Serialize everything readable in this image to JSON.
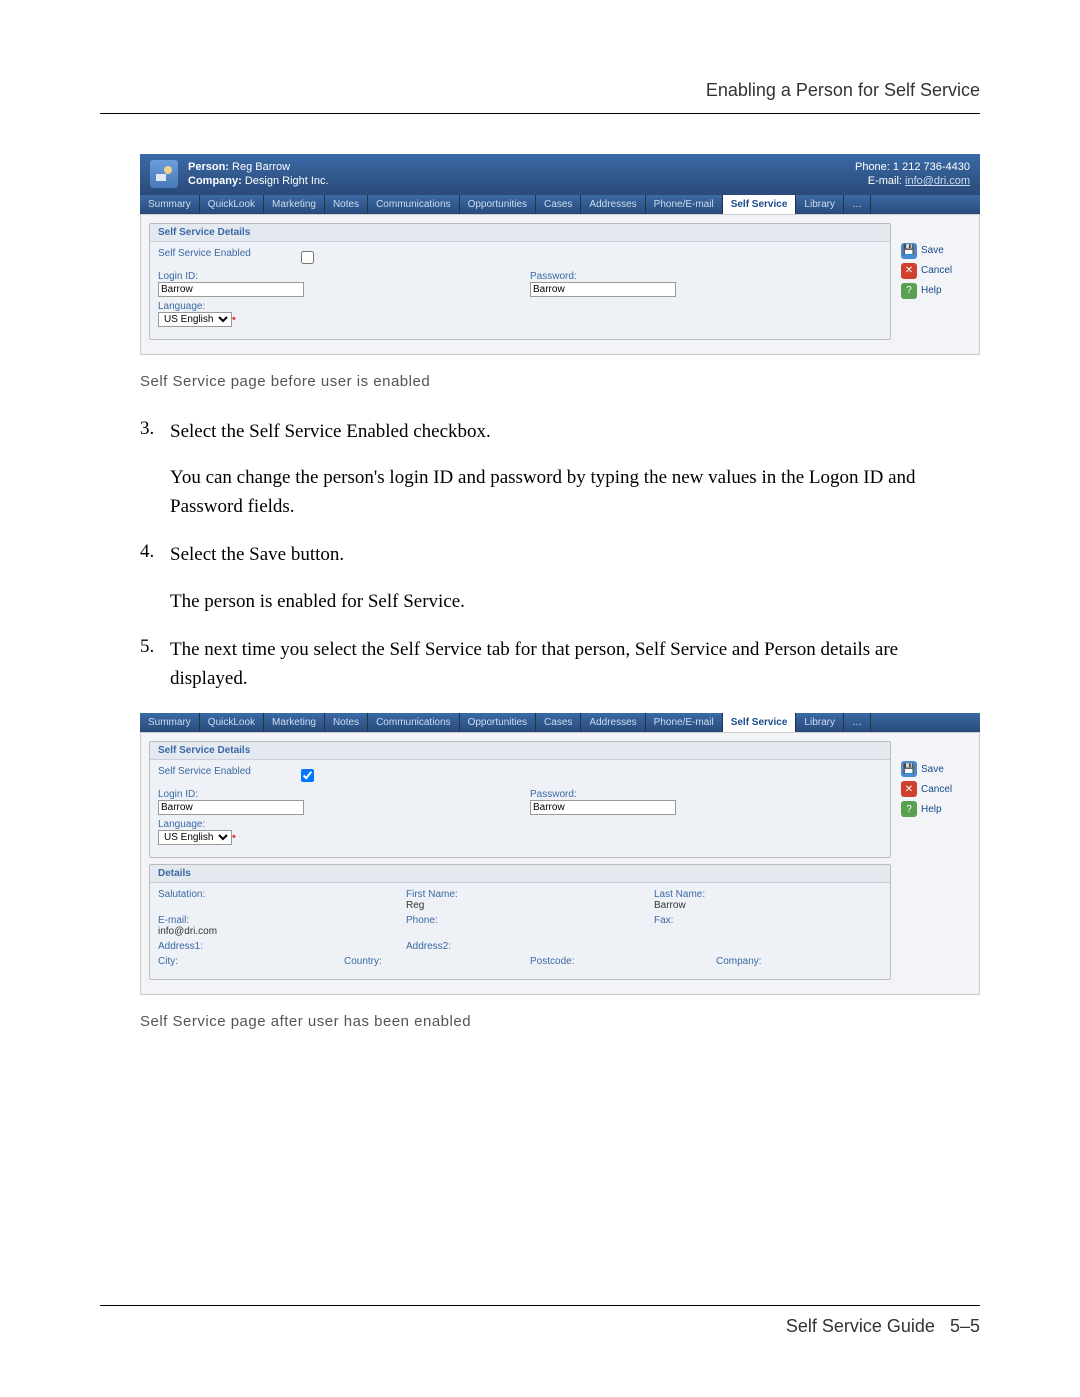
{
  "header": "Enabling a Person for Self Service",
  "shot1": {
    "person_label": "Person:",
    "person": "Reg Barrow",
    "company_label": "Company:",
    "company": "Design Right Inc.",
    "phone_label": "Phone:",
    "phone": "1 212 736-4430",
    "email_label": "E-mail:",
    "email": "info@dri.com",
    "tabs": [
      "Summary",
      "QuickLook",
      "Marketing",
      "Notes",
      "Communications",
      "Opportunities",
      "Cases",
      "Addresses",
      "Phone/E-mail",
      "Self Service",
      "Library",
      "…"
    ],
    "panel_title": "Self Service Details",
    "sse_label": "Self Service Enabled",
    "login_label": "Login ID:",
    "login_val": "Barrow",
    "password_label": "Password:",
    "password_val": "Barrow",
    "language_label": "Language:",
    "language_val": "US English",
    "save": "Save",
    "cancel": "Cancel",
    "help": "Help"
  },
  "caption1": "Self Service page before user is enabled",
  "steps": [
    {
      "n": "3.",
      "p": [
        "Select the Self Service Enabled checkbox.",
        "You can change the person's login ID and password by typing the new values in the Logon ID and Password fields."
      ]
    },
    {
      "n": "4.",
      "p": [
        "Select the Save button.",
        "The person is enabled for Self Service."
      ]
    },
    {
      "n": "5.",
      "p": [
        "The next time you select the Self Service tab for that person, Self Service and Person details are displayed."
      ]
    }
  ],
  "shot2": {
    "tabs": [
      "Summary",
      "QuickLook",
      "Marketing",
      "Notes",
      "Communications",
      "Opportunities",
      "Cases",
      "Addresses",
      "Phone/E-mail",
      "Self Service",
      "Library",
      "…"
    ],
    "panel1_title": "Self Service Details",
    "sse_label": "Self Service Enabled",
    "login_label": "Login ID:",
    "login_val": "Barrow",
    "password_label": "Password:",
    "password_val": "Barrow",
    "language_label": "Language:",
    "language_val": "US English",
    "panel2_title": "Details",
    "salutation_label": "Salutation:",
    "salutation_val": "",
    "firstname_label": "First Name:",
    "firstname_val": "Reg",
    "lastname_label": "Last Name:",
    "lastname_val": "Barrow",
    "email_label": "E-mail:",
    "email_val": "info@dri.com",
    "phone_label": "Phone:",
    "phone_val": "",
    "fax_label": "Fax:",
    "fax_val": "",
    "address1_label": "Address1:",
    "address2_label": "Address2:",
    "city_label": "City:",
    "country_label": "Country:",
    "postcode_label": "Postcode:",
    "company_label": "Company:",
    "save": "Save",
    "cancel": "Cancel",
    "help": "Help"
  },
  "caption2": "Self Service page after user has been enabled",
  "footer_left": "Self Service Guide",
  "footer_right": "5–5"
}
